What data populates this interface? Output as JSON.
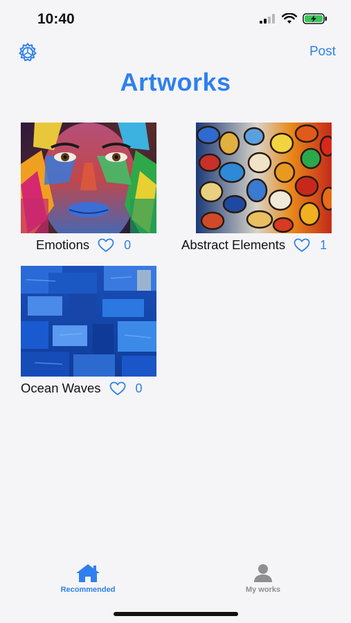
{
  "status_bar": {
    "time": "10:40"
  },
  "nav": {
    "settings_icon": "gear-icon",
    "post_label": "Post"
  },
  "title": "Artworks",
  "artworks": [
    {
      "title": "Emotions",
      "likes": "0"
    },
    {
      "title": "Abstract Elements",
      "likes": "1"
    },
    {
      "title": "Ocean Waves",
      "likes": "0"
    }
  ],
  "tabs": [
    {
      "label": "Recommended",
      "icon": "home-icon",
      "active": true
    },
    {
      "label": "My works",
      "icon": "person-icon",
      "active": false
    }
  ],
  "colors": {
    "accent": "#2f80ed",
    "inactive": "#8e8e93",
    "background": "#f5f5f7",
    "battery_fill": "#34c759"
  }
}
